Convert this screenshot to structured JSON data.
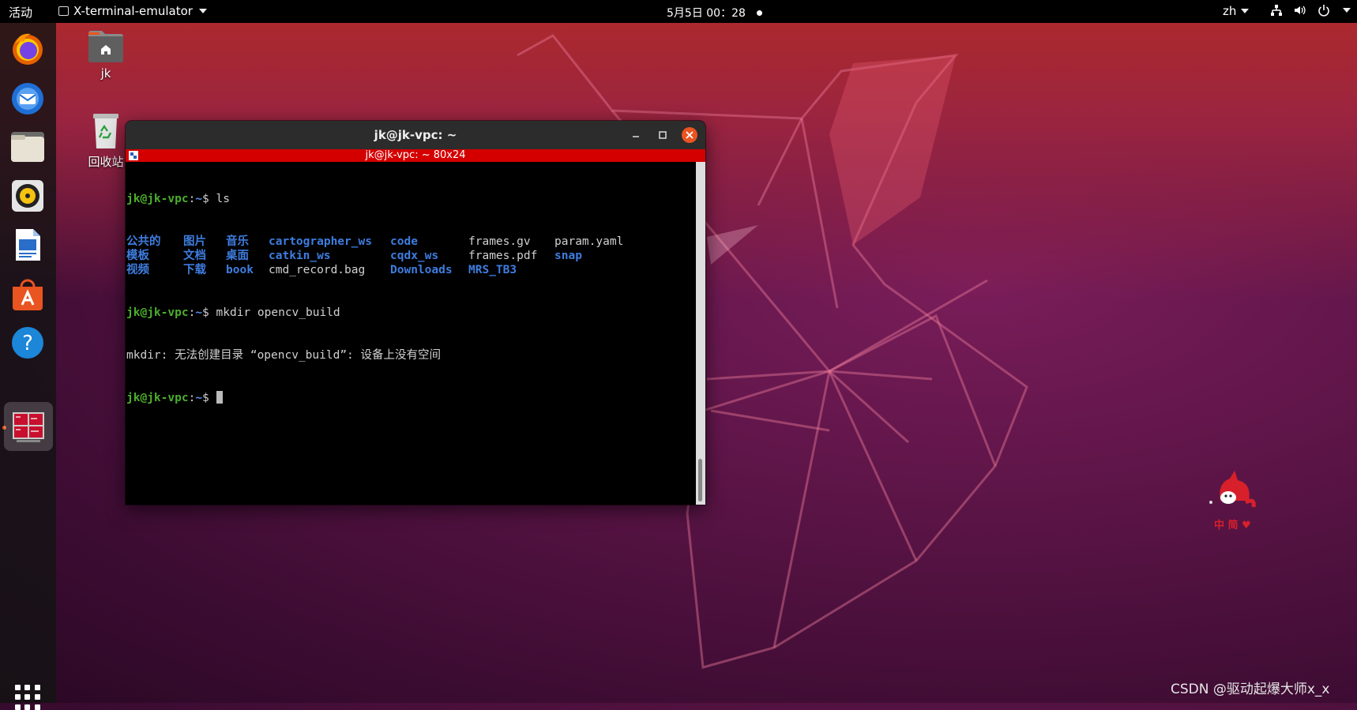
{
  "topbar": {
    "activities": "活动",
    "app_name": "X-terminal-emulator",
    "clock": "5月5日 00：28",
    "lang": "zh"
  },
  "dock": {
    "items": [
      {
        "name": "firefox-icon"
      },
      {
        "name": "thunderbird-icon"
      },
      {
        "name": "files-icon"
      },
      {
        "name": "rhythmbox-icon"
      },
      {
        "name": "libreoffice-writer-icon"
      },
      {
        "name": "software-center-icon"
      },
      {
        "name": "help-icon"
      },
      {
        "name": "xterm-icon",
        "active": true
      }
    ]
  },
  "desktop": {
    "home_label": "jk",
    "trash_label": "回收站"
  },
  "window": {
    "title": "jk@jk-vpc: ~",
    "xterm_title": "jk@jk-vpc: ~ 80x24"
  },
  "terminal": {
    "prompt_user": "jk@jk-vpc",
    "prompt_sep": ":",
    "prompt_path": "~",
    "prompt_end": "$ ",
    "cmd1": "ls",
    "ls_rows": [
      [
        {
          "t": "公共的",
          "d": true
        },
        {
          "t": "图片",
          "d": true
        },
        {
          "t": "音乐",
          "d": true
        },
        {
          "t": "cartographer_ws",
          "d": true
        },
        {
          "t": "code",
          "d": true
        },
        {
          "t": "frames.gv",
          "d": false
        },
        {
          "t": "param.yaml",
          "d": false
        }
      ],
      [
        {
          "t": "模板",
          "d": true
        },
        {
          "t": "文档",
          "d": true
        },
        {
          "t": "桌面",
          "d": true
        },
        {
          "t": "catkin_ws",
          "d": true
        },
        {
          "t": "cqdx_ws",
          "d": true
        },
        {
          "t": "frames.pdf",
          "d": false
        },
        {
          "t": "snap",
          "d": true
        }
      ],
      [
        {
          "t": "视频",
          "d": true
        },
        {
          "t": "下载",
          "d": true
        },
        {
          "t": "book",
          "d": true
        },
        {
          "t": "cmd_record.bag",
          "d": false
        },
        {
          "t": "Downloads",
          "d": true
        },
        {
          "t": "MRS_TB3",
          "d": true
        },
        {
          "t": "",
          "d": false
        }
      ]
    ],
    "cmd2": "mkdir opencv_build",
    "error": "mkdir: 无法创建目录 “opencv_build”: 设备上没有空间"
  },
  "watermark": "CSDN @驱动起爆大师x_x",
  "mascot_text": "中 简 ♥",
  "colors": {
    "accent": "#e95420",
    "prompt_green": "#4cae2c",
    "dir_blue": "#3e7de0",
    "xterm_red": "#d40000"
  }
}
